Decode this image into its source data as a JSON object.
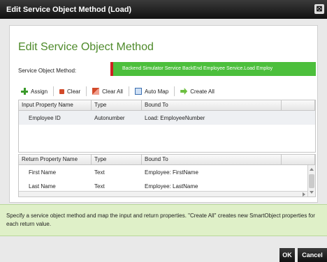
{
  "window": {
    "title": "Edit Service Object Method (Load)",
    "close_glyph": "⊠"
  },
  "heading": "Edit Service Object Method",
  "method": {
    "label": "Service Object Method:",
    "value": "Backend Simulator Service BackEnd Employee Service.Load Employ"
  },
  "toolbar": {
    "assign": "Assign",
    "clear": "Clear",
    "clear_all": "Clear All",
    "auto_map": "Auto Map",
    "create_all": "Create All"
  },
  "input_grid": {
    "columns": [
      "Input Property Name",
      "Type",
      "Bound To"
    ],
    "rows": [
      {
        "name": "Employee ID",
        "type": "Autonumber",
        "bound": "Load: EmployeeNumber"
      }
    ]
  },
  "return_grid": {
    "columns": [
      "Return Property Name",
      "Type",
      "Bound To"
    ],
    "rows": [
      {
        "name": "First Name",
        "type": "Text",
        "bound": "Employee: FirstName"
      },
      {
        "name": "Last Name",
        "type": "Text",
        "bound": "Employee: LastName"
      }
    ]
  },
  "help_text": "Specify a service object method and map the input and return properties. \"Create All\" creates new SmartObject properties for each return value.",
  "buttons": {
    "ok": "OK",
    "cancel": "Cancel"
  },
  "colors": {
    "accent_green": "#4e8a2a",
    "field_green": "#4cbf3c",
    "help_bg": "#dff0c8"
  }
}
